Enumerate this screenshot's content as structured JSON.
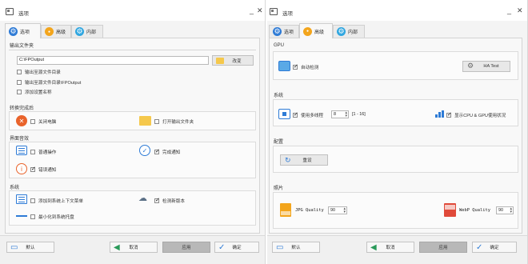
{
  "left": {
    "title": "选项",
    "tabs": [
      "选项",
      "高级",
      "内部"
    ],
    "output_folder": {
      "header": "输出文件夹",
      "path": "C:\\FPOutput",
      "change_button": "改变",
      "options": [
        {
          "label": "输出至源文件目录",
          "checked": false
        },
        {
          "label": "输出至源文件目录\\FPOutput",
          "checked": false
        },
        {
          "label": "添加设置名称",
          "checked": false
        }
      ]
    },
    "after_conversion": {
      "header": "转换完成后",
      "shutdown": "关闭电脑",
      "open_folder": "打开输出文件夹"
    },
    "interface_sound": {
      "header": "界面音效",
      "normal_op": "普通操作",
      "done_notice": "完成通知",
      "error_notice": "错误通知"
    },
    "system": {
      "header": "系统",
      "context_menu": "添加到系统上下文菜单",
      "check_update": "检测新版本",
      "minimize_tray": "最小化到系统托盘"
    }
  },
  "right": {
    "title": "选项",
    "tabs": [
      "选项",
      "高级",
      "内部"
    ],
    "gpu": {
      "header": "GPU",
      "auto_detect": "自动检测",
      "ha_test": "HA Test"
    },
    "system": {
      "header": "系统",
      "multithread": "使用多线程",
      "thread_value": "8",
      "thread_range": "[1 - 16]",
      "show_cpu_gpu": "显示CPU & GPU使用状况"
    },
    "config": {
      "header": "配置",
      "reset": "重设"
    },
    "image": {
      "header": "照片",
      "jpg_label": "JPG Quality",
      "jpg_value": "90",
      "webp_label": "WebP Quality",
      "webp_value": "90"
    }
  },
  "footer": {
    "default": "默认",
    "cancel": "取消",
    "apply": "应用",
    "ok": "确定"
  },
  "colors": {
    "accent_blue": "#2e7bd6",
    "warn_orange": "#e9632b",
    "folder_yellow": "#f5c84c",
    "apply_gray": "#b8b8b8"
  }
}
